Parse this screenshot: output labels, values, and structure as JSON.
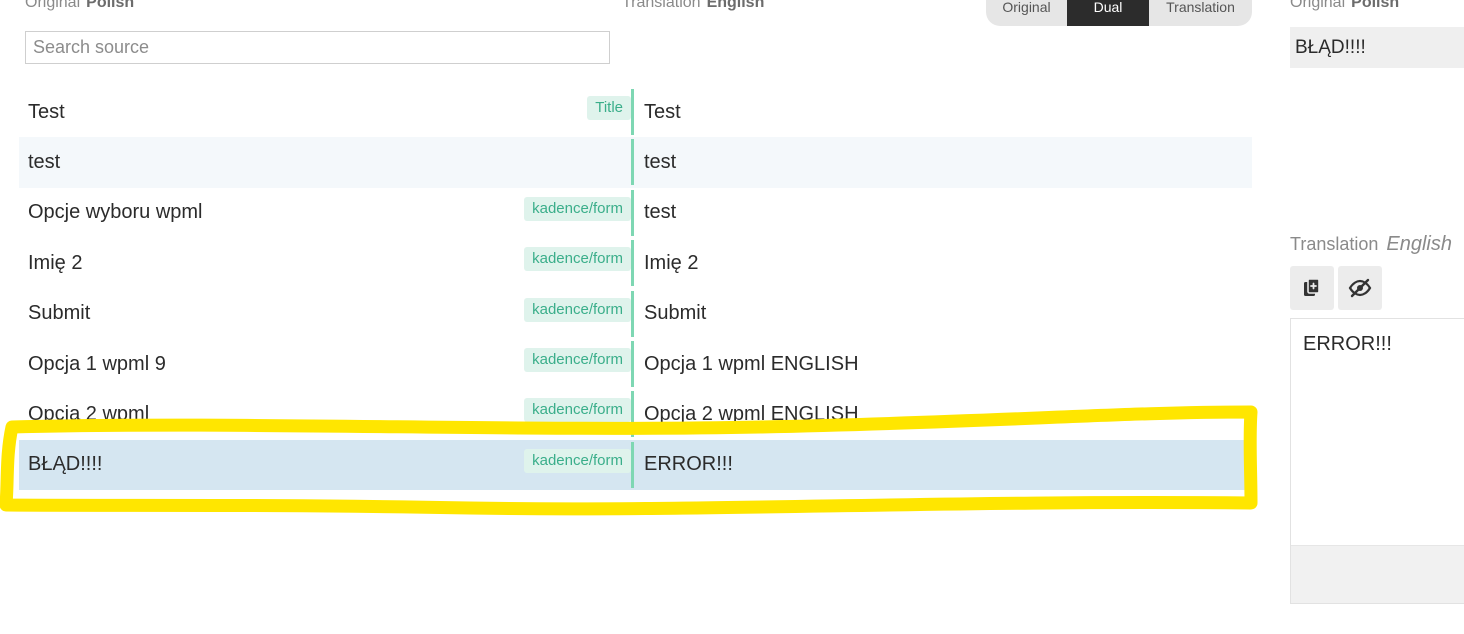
{
  "header": {
    "original_label": "Original",
    "original_lang": "Polish",
    "translation_label": "Translation",
    "translation_lang": "English"
  },
  "search": {
    "placeholder": "Search source",
    "value": ""
  },
  "view_toggle": {
    "original": "Original",
    "dual": "Dual",
    "translation": "Translation",
    "selected": "Dual"
  },
  "rows": [
    {
      "source": "Test",
      "tag": "Title",
      "translation": "Test"
    },
    {
      "source": "test",
      "tag": "",
      "translation": "test"
    },
    {
      "source": "Opcje wyboru wpml",
      "tag": "kadence/form",
      "translation": "test"
    },
    {
      "source": "Imię 2",
      "tag": "kadence/form",
      "translation": "Imię 2"
    },
    {
      "source": "Submit",
      "tag": "kadence/form",
      "translation": "Submit"
    },
    {
      "source": "Opcja 1 wpml 9",
      "tag": "kadence/form",
      "translation": "Opcja 1 wpml ENGLISH"
    },
    {
      "source": "Opcja 2 wpml",
      "tag": "kadence/form",
      "translation": "Opcja 2 wpml ENGLISH"
    },
    {
      "source": "BŁĄD!!!!",
      "tag": "kadence/form",
      "translation": "ERROR!!!"
    }
  ],
  "selected_row_index": 7,
  "side_panel": {
    "original_label": "Original",
    "original_lang": "Polish",
    "source_text": "BŁĄD!!!!",
    "translation_label": "Translation",
    "translation_lang": "English",
    "translation_value": "ERROR!!!",
    "icons": [
      "copy-source-icon",
      "hide-eye-icon"
    ]
  },
  "colors": {
    "accent_green": "#7ed7b3",
    "tag_bg": "#dff3ec",
    "tag_text": "#3aae8a",
    "selected_row": "#d5e6f1",
    "highlight": "#ffe600",
    "toggle_active": "#2c2c2c"
  }
}
